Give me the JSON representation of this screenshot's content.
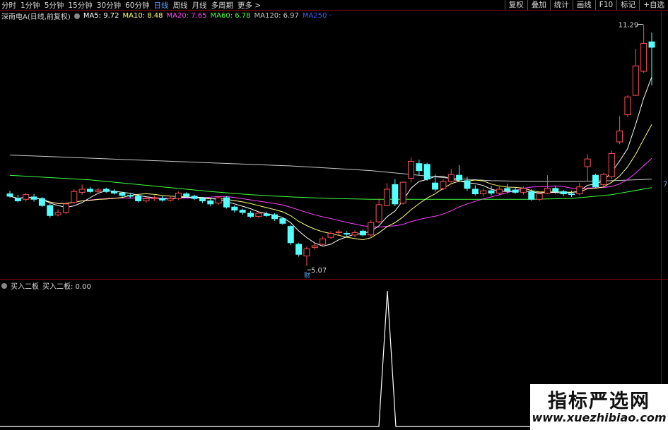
{
  "toolbar": {
    "periods": [
      "分时",
      "1分钟",
      "5分钟",
      "15分钟",
      "30分钟",
      "60分钟",
      "日线",
      "周线",
      "月线",
      "多周期",
      "更多 >"
    ],
    "active_period": "日线",
    "buttons": [
      "复权",
      "叠加",
      "统计",
      "画线",
      "F10",
      "标记",
      "+自选"
    ]
  },
  "legend": {
    "title": "深南电A(日线,前复权)",
    "ma5": "MA5: 9.72",
    "ma10": "MA10: 8.48",
    "ma20": "MA20: 7.65",
    "ma60": "MA60: 6.78",
    "ma120": "MA120: 6.97",
    "ma250": "MA250 -"
  },
  "indicator_legend": {
    "name": "买入二板",
    "value": "买入二板: 0.00"
  },
  "colors": {
    "up": "#ff5050",
    "down": "#54ffff",
    "ma5": "#ffffff",
    "ma10": "#ffff80",
    "ma20": "#ff40ff",
    "ma60": "#40ff40",
    "ma120": "#c8c8c8",
    "ma250": "#3060ff",
    "signal": "#ffffff"
  },
  "annotations": {
    "high_label": "11.29",
    "low_label": "5.07",
    "marker": "财",
    "right_edge": "7"
  },
  "watermark": {
    "cn": "指标严选网",
    "url": "www.xuezhibiao.com"
  },
  "chart_data": [
    {
      "type": "candlestick",
      "title": "深南电A(日线,前复权)",
      "ylim": [
        5.0,
        11.3
      ],
      "candles": [
        [
          6.92,
          6.86,
          7.0,
          6.82
        ],
        [
          6.8,
          6.74,
          6.9,
          6.7
        ],
        [
          6.78,
          6.9,
          6.94,
          6.72
        ],
        [
          6.84,
          6.78,
          6.92,
          6.72
        ],
        [
          6.8,
          6.62,
          6.84,
          6.58
        ],
        [
          6.62,
          6.36,
          6.66,
          6.3
        ],
        [
          6.38,
          6.44,
          6.52,
          6.34
        ],
        [
          6.44,
          6.66,
          6.7,
          6.4
        ],
        [
          6.7,
          6.98,
          7.04,
          6.66
        ],
        [
          6.96,
          7.04,
          7.16,
          6.9
        ],
        [
          7.04,
          6.98,
          7.1,
          6.94
        ],
        [
          6.98,
          7.02,
          7.08,
          6.92
        ],
        [
          7.04,
          6.98,
          7.08,
          6.94
        ],
        [
          6.98,
          6.94,
          7.04,
          6.9
        ],
        [
          6.94,
          6.88,
          6.98,
          6.84
        ],
        [
          6.88,
          6.86,
          6.94,
          6.8
        ],
        [
          6.86,
          6.74,
          6.9,
          6.7
        ],
        [
          6.74,
          6.8,
          6.84,
          6.7
        ],
        [
          6.8,
          6.82,
          6.88,
          6.74
        ],
        [
          6.8,
          6.76,
          6.86,
          6.72
        ],
        [
          6.76,
          6.8,
          6.86,
          6.72
        ],
        [
          6.8,
          6.94,
          6.98,
          6.76
        ],
        [
          6.92,
          6.86,
          6.96,
          6.82
        ],
        [
          6.86,
          6.8,
          6.9,
          6.76
        ],
        [
          6.8,
          6.74,
          6.84,
          6.68
        ],
        [
          6.74,
          6.66,
          6.78,
          6.6
        ],
        [
          6.68,
          6.82,
          6.86,
          6.64
        ],
        [
          6.82,
          6.58,
          6.86,
          6.54
        ],
        [
          6.58,
          6.5,
          6.62,
          6.44
        ],
        [
          6.5,
          6.44,
          6.54,
          6.38
        ],
        [
          6.42,
          6.34,
          6.48,
          6.3
        ],
        [
          6.34,
          6.42,
          6.46,
          6.3
        ],
        [
          6.4,
          6.36,
          6.46,
          6.32
        ],
        [
          6.38,
          6.28,
          6.42,
          6.22
        ],
        [
          6.28,
          6.16,
          6.32,
          6.12
        ],
        [
          6.08,
          5.66,
          6.12,
          5.6
        ],
        [
          5.62,
          5.36,
          5.66,
          5.3
        ],
        [
          5.32,
          5.5,
          5.56,
          5.07
        ],
        [
          5.54,
          5.58,
          5.64,
          5.48
        ],
        [
          5.62,
          5.76,
          5.82,
          5.58
        ],
        [
          5.8,
          5.9,
          5.96,
          5.76
        ],
        [
          5.92,
          5.94,
          6.0,
          5.84
        ],
        [
          5.9,
          5.88,
          5.96,
          5.82
        ],
        [
          5.86,
          5.92,
          5.98,
          5.8
        ],
        [
          5.96,
          5.86,
          6.0,
          5.82
        ],
        [
          5.86,
          6.18,
          6.24,
          5.82
        ],
        [
          6.2,
          6.64,
          6.8,
          6.16
        ],
        [
          6.62,
          7.04,
          7.2,
          6.6
        ],
        [
          7.16,
          6.66,
          7.3,
          6.6
        ],
        [
          6.68,
          7.22,
          7.24,
          6.64
        ],
        [
          7.32,
          7.76,
          7.86,
          7.22
        ],
        [
          7.7,
          7.52,
          7.8,
          7.4
        ],
        [
          7.68,
          7.3,
          7.72,
          7.26
        ],
        [
          7.2,
          7.04,
          7.42,
          6.98
        ],
        [
          7.06,
          7.24,
          7.3,
          7.02
        ],
        [
          7.24,
          7.42,
          7.56,
          7.16
        ],
        [
          7.4,
          7.28,
          7.66,
          7.22
        ],
        [
          7.26,
          7.06,
          7.36,
          7.0
        ],
        [
          7.04,
          6.92,
          7.14,
          6.88
        ],
        [
          6.92,
          7.0,
          7.06,
          6.86
        ],
        [
          7.0,
          6.94,
          7.12,
          6.88
        ],
        [
          6.94,
          7.04,
          7.14,
          6.9
        ],
        [
          7.06,
          7.0,
          7.18,
          6.94
        ],
        [
          7.02,
          6.96,
          7.1,
          6.92
        ],
        [
          6.96,
          7.06,
          7.12,
          6.9
        ],
        [
          6.98,
          6.78,
          7.04,
          6.74
        ],
        [
          6.78,
          6.92,
          6.98,
          6.74
        ],
        [
          6.94,
          7.06,
          7.4,
          6.92
        ],
        [
          7.06,
          6.98,
          7.12,
          6.92
        ],
        [
          6.98,
          6.92,
          7.02,
          6.86
        ],
        [
          6.92,
          6.9,
          7.0,
          6.84
        ],
        [
          6.92,
          7.1,
          7.2,
          6.88
        ],
        [
          7.62,
          7.82,
          7.94,
          7.24
        ],
        [
          7.4,
          7.1,
          7.44,
          7.06
        ],
        [
          7.16,
          7.42,
          7.46,
          7.1
        ],
        [
          7.36,
          7.96,
          8.04,
          7.3
        ],
        [
          8.26,
          8.54,
          8.92,
          8.2
        ],
        [
          8.96,
          9.42,
          9.46,
          8.9
        ],
        [
          9.46,
          10.22,
          10.66,
          9.44
        ],
        [
          10.08,
          10.8,
          11.29,
          10.04
        ],
        [
          10.84,
          10.7,
          11.08,
          9.72
        ]
      ]
    },
    {
      "type": "line",
      "title": "买入二板",
      "ylim": [
        0,
        1
      ],
      "signal_index": 58,
      "value": 0.0
    }
  ]
}
